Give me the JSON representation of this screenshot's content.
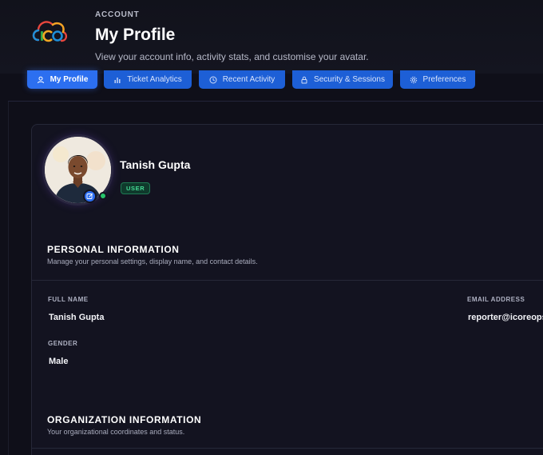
{
  "header": {
    "eyebrow": "ACCOUNT",
    "title": "My Profile",
    "subtitle": "View your account info, activity stats, and customise your avatar."
  },
  "tabs": [
    {
      "label": "My Profile",
      "icon": "user-icon",
      "active": true
    },
    {
      "label": "Ticket Analytics",
      "icon": "bar-chart-icon",
      "active": false
    },
    {
      "label": "Recent Activity",
      "icon": "clock-icon",
      "active": false
    },
    {
      "label": "Security & Sessions",
      "icon": "lock-icon",
      "active": false
    },
    {
      "label": "Preferences",
      "icon": "gear-icon",
      "active": false
    }
  ],
  "profile": {
    "name": "Tanish Gupta",
    "role": "USER",
    "online": true
  },
  "personal": {
    "title": "PERSONAL INFORMATION",
    "description": "Manage your personal settings, display name, and contact details.",
    "full_name_label": "FULL NAME",
    "full_name": "Tanish Gupta",
    "email_label": "EMAIL ADDRESS",
    "email": "reporter@icoreops.i",
    "gender_label": "GENDER",
    "gender": "Male"
  },
  "organization": {
    "title": "ORGANIZATION INFORMATION",
    "description": "Your organizational coordinates and status."
  },
  "colors": {
    "background": "#0f0f19",
    "accent": "#2c6ff0",
    "online": "#27c46b",
    "badge_text": "#45d994"
  }
}
